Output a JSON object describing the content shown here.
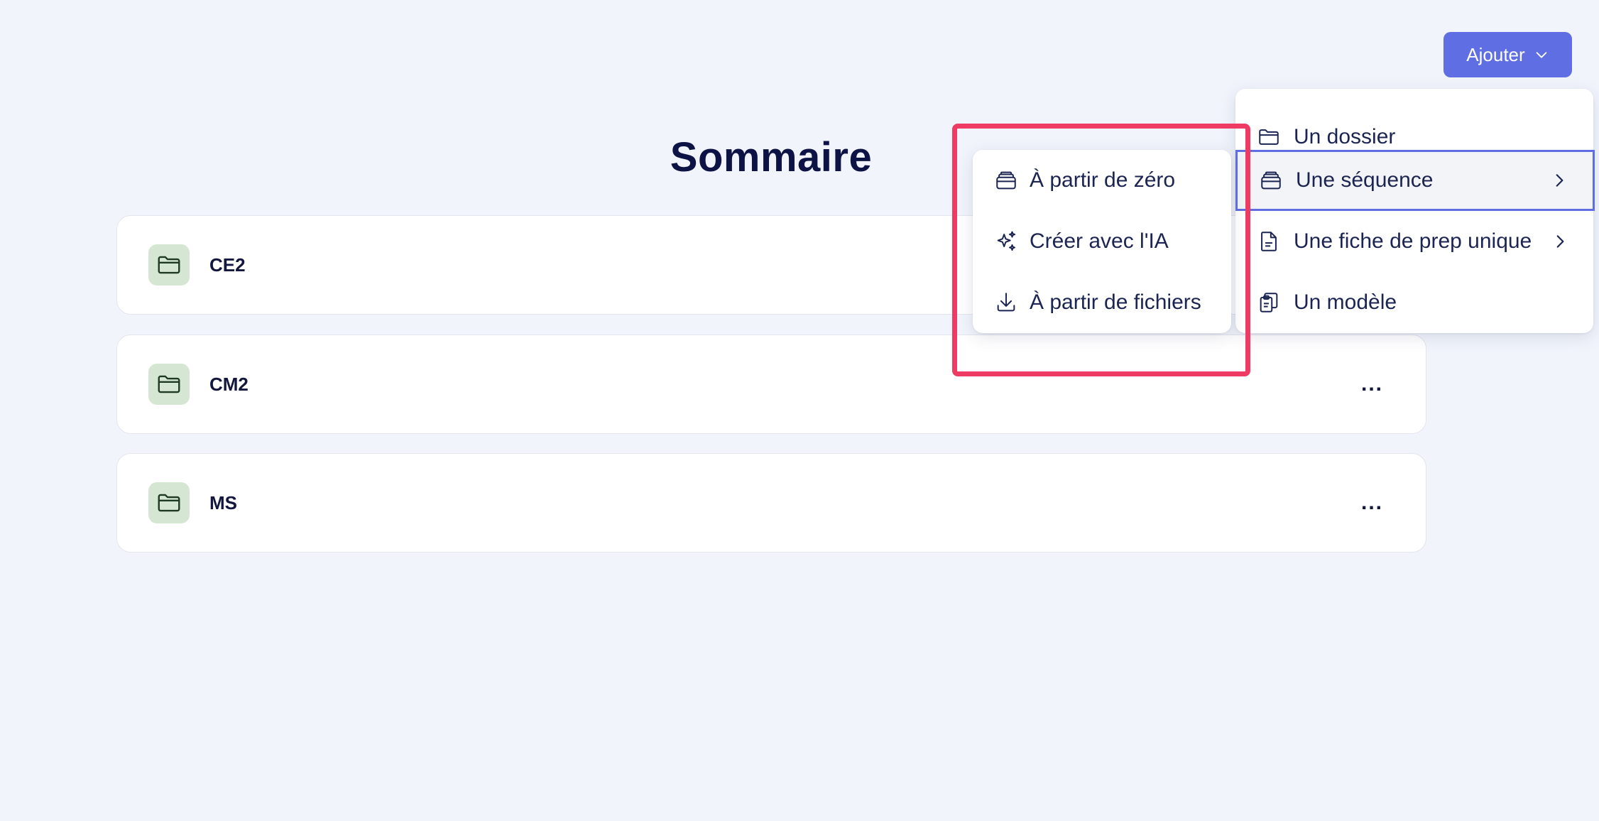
{
  "header": {
    "add_button_label": "Ajouter",
    "title": "Sommaire"
  },
  "folders": [
    {
      "name": "CE2",
      "menu_label": "..."
    },
    {
      "name": "CM2",
      "menu_label": "..."
    },
    {
      "name": "MS",
      "menu_label": "..."
    }
  ],
  "add_menu": {
    "items": [
      {
        "label": "Un dossier",
        "icon": "folder-icon"
      },
      {
        "label": "Une séquence",
        "icon": "stack-icon",
        "has_submenu": true,
        "active": true
      },
      {
        "label": "Une fiche de prep unique",
        "icon": "document-icon",
        "has_submenu": true
      },
      {
        "label": "Un modèle",
        "icon": "clipboard-copy-icon"
      }
    ]
  },
  "sequence_submenu": {
    "items": [
      {
        "label": "À partir de zéro",
        "icon": "stack-icon"
      },
      {
        "label": "Créer avec l'IA",
        "icon": "sparkles-icon"
      },
      {
        "label": "À partir de fichiers",
        "icon": "download-icon"
      }
    ]
  },
  "colors": {
    "background": "#f1f4fb",
    "accent": "#5f6fe3",
    "highlight": "#ee3b63",
    "folder_icon_bg": "#d5e6d3",
    "title": "#0e1345"
  }
}
